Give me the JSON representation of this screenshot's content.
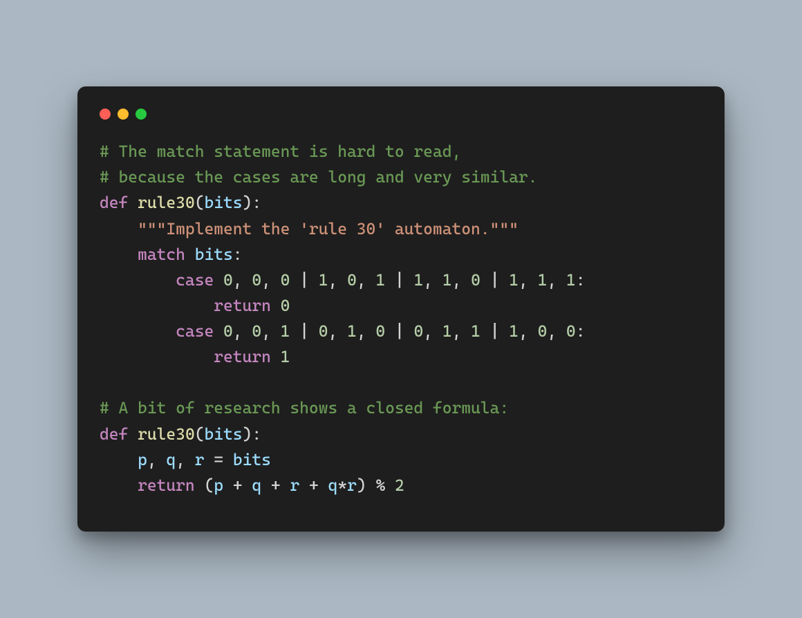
{
  "code": {
    "comment1_line1": "# The match statement is hard to read,",
    "comment1_line2": "# because the cases are long and very similar.",
    "def1_def": "def",
    "def1_name": "rule30",
    "def1_lp": "(",
    "def1_param": "bits",
    "def1_rp_colon": "):",
    "docstring": "\"\"\"Implement the 'rule 30' automaton.\"\"\"",
    "match_kw": "match",
    "match_var": "bits",
    "match_colon": ":",
    "case_kw": "case",
    "n0": "0",
    "n1": "1",
    "n2": "2",
    "comma_sp": ", ",
    "pipe": " | ",
    "colon": ":",
    "return_kw": "return",
    "comment2": "# A bit of research shows a closed formula:",
    "pvar": "p",
    "qvar": "q",
    "rvar": "r",
    "eq": " = ",
    "bits_var": "bits",
    "lp": "(",
    "rp": ")",
    "plus": " + ",
    "star": "*",
    "mod": " % "
  }
}
